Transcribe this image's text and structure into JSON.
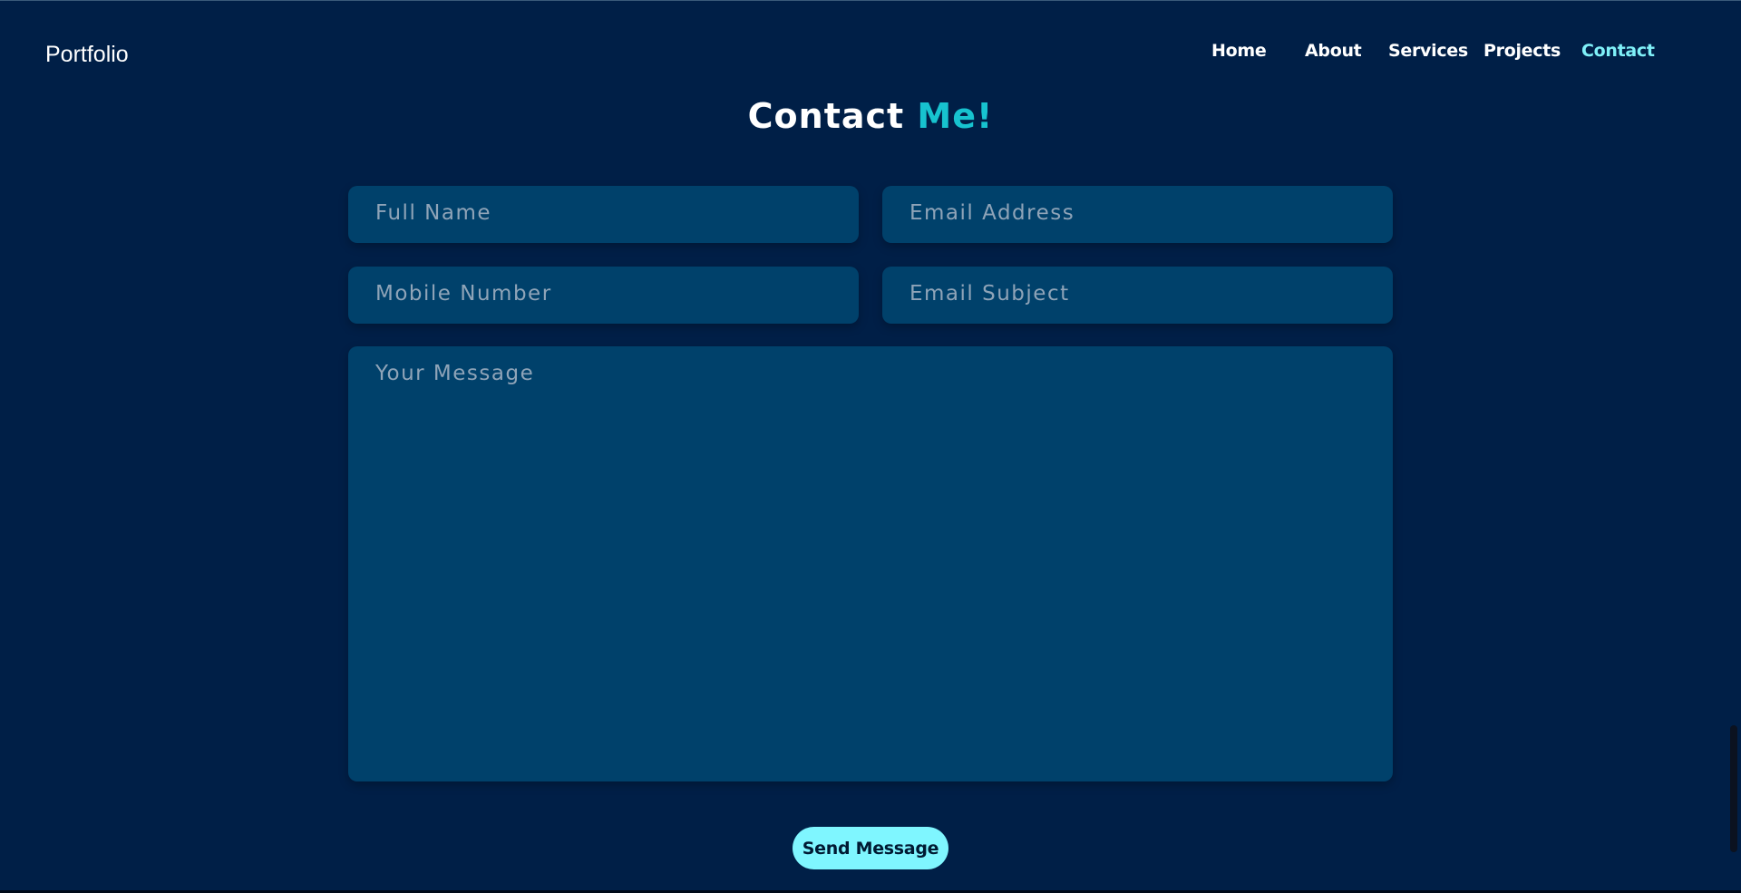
{
  "header": {
    "logo": "Portfolio",
    "nav": [
      {
        "label": "Home",
        "active": false
      },
      {
        "label": "About",
        "active": false
      },
      {
        "label": "Services",
        "active": false
      },
      {
        "label": "Projects",
        "active": false
      },
      {
        "label": "Contact",
        "active": true
      }
    ]
  },
  "contact": {
    "heading_main": "Contact ",
    "heading_accent": "Me!",
    "fields": {
      "full_name": "Full Name",
      "email": "Email Address",
      "mobile": "Mobile Number",
      "subject": "Email Subject",
      "message": "Your Message"
    },
    "submit_label": "Send Message"
  },
  "colors": {
    "background": "#001f47",
    "field": "#00416b",
    "accent": "#17c3cf",
    "active_nav": "#7ff0f8",
    "button": "#7ff6ff"
  }
}
